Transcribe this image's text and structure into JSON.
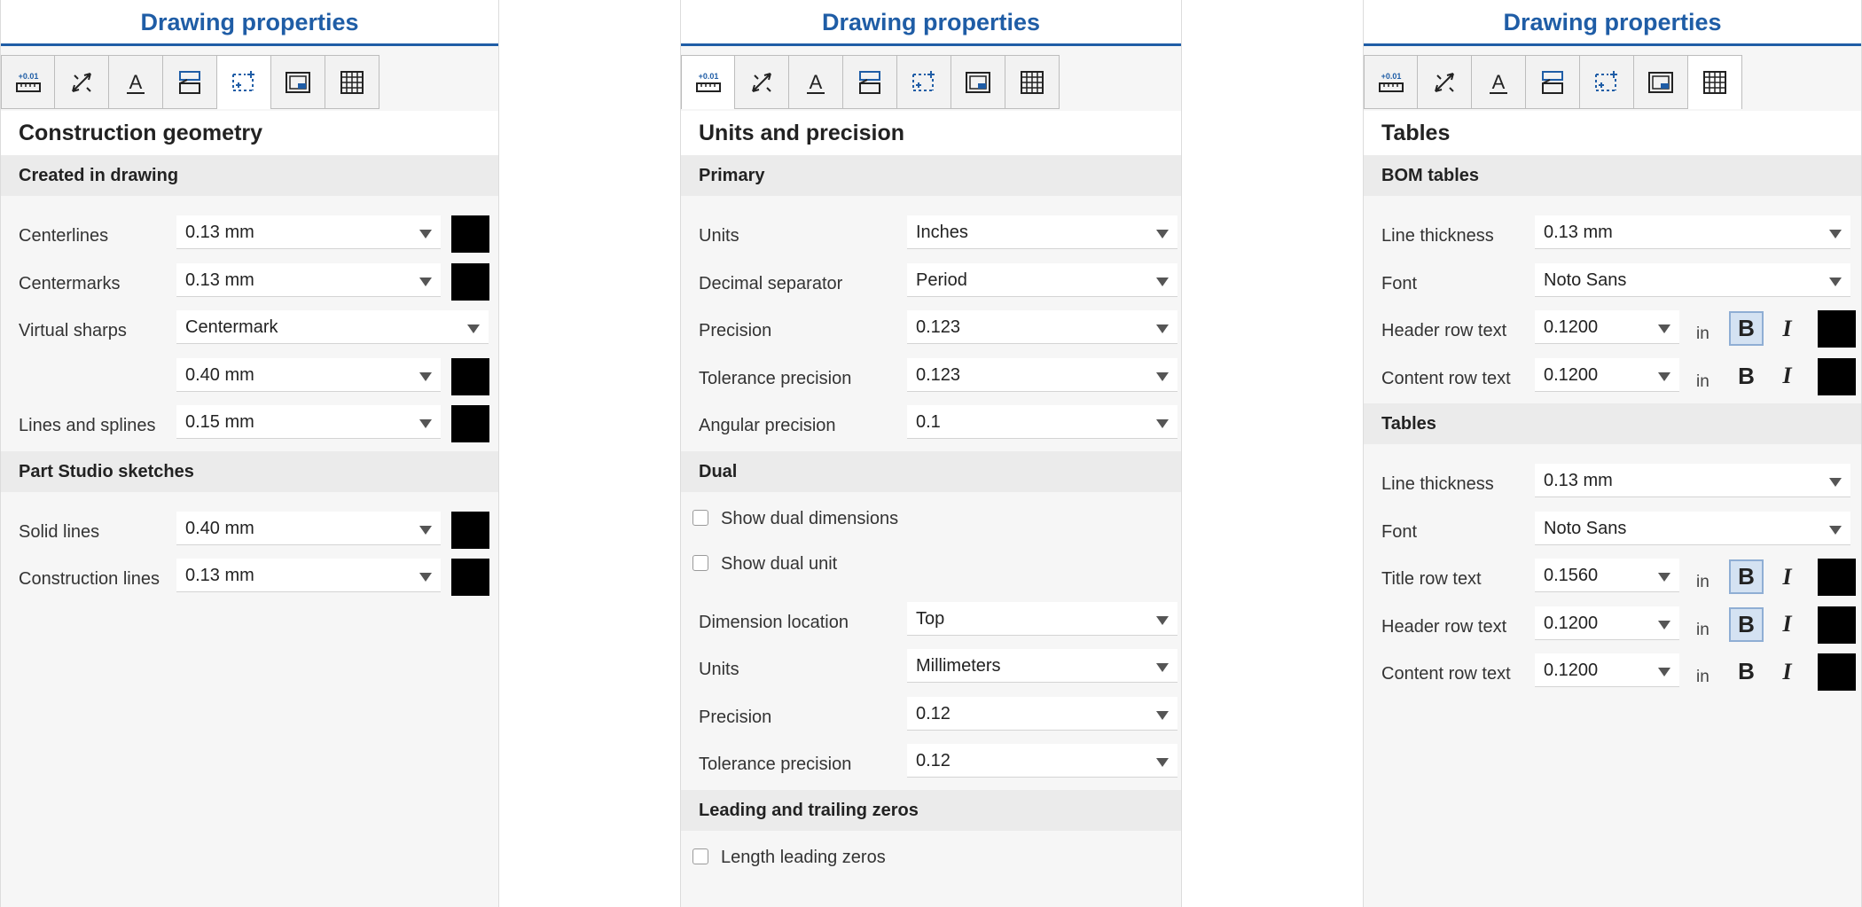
{
  "panels": [
    {
      "title": "Drawing properties",
      "section_title": "Construction geometry",
      "groups": [
        {
          "title": "Created in drawing"
        },
        {
          "title": "Part Studio sketches"
        }
      ],
      "rows": {
        "centerlines": {
          "label": "Centerlines",
          "value": "0.13 mm"
        },
        "centermarks": {
          "label": "Centermarks",
          "value": "0.13 mm"
        },
        "virtual_sharps": {
          "label": "Virtual sharps",
          "value": "Centermark"
        },
        "virtual_sharps_size": {
          "label": "",
          "value": "0.40 mm"
        },
        "lines_splines": {
          "label": "Lines and splines",
          "value": "0.15 mm"
        },
        "solid_lines": {
          "label": "Solid lines",
          "value": "0.40 mm"
        },
        "construction_lines": {
          "label": "Construction lines",
          "value": "0.13 mm"
        }
      }
    },
    {
      "title": "Drawing properties",
      "section_title": "Units and precision",
      "groups": [
        {
          "title": "Primary"
        },
        {
          "title": "Dual"
        },
        {
          "title": "Leading and trailing zeros"
        }
      ],
      "primary": [
        {
          "label": "Units",
          "value": "Inches"
        },
        {
          "label": "Decimal separator",
          "value": "Period"
        },
        {
          "label": "Precision",
          "value": "0.123"
        },
        {
          "label": "Tolerance precision",
          "value": "0.123"
        },
        {
          "label": "Angular precision",
          "value": "0.1"
        }
      ],
      "dual_checks": [
        "Show dual dimensions",
        "Show dual unit"
      ],
      "dual": [
        {
          "label": "Dimension location",
          "value": "Top"
        },
        {
          "label": "Units",
          "value": "Millimeters"
        },
        {
          "label": "Precision",
          "value": "0.12"
        },
        {
          "label": "Tolerance precision",
          "value": "0.12"
        }
      ],
      "zeros_checks": [
        "Length leading zeros"
      ]
    },
    {
      "title": "Drawing properties",
      "section_title": "Tables",
      "groups": [
        {
          "title": "BOM tables"
        },
        {
          "title": "Tables"
        }
      ],
      "unit_label": "in",
      "bold_glyph": "B",
      "italic_glyph": "I",
      "bom": {
        "line_thickness": {
          "label": "Line thickness",
          "value": "0.13 mm"
        },
        "font": {
          "label": "Font",
          "value": "Noto Sans"
        },
        "header": {
          "label": "Header row text",
          "value": "0.1200"
        },
        "content": {
          "label": "Content row text",
          "value": "0.1200"
        }
      },
      "tables": {
        "line_thickness": {
          "label": "Line thickness",
          "value": "0.13 mm"
        },
        "font": {
          "label": "Font",
          "value": "Noto Sans"
        },
        "title": {
          "label": "Title row text",
          "value": "0.1560"
        },
        "header": {
          "label": "Header row text",
          "value": "0.1200"
        },
        "content": {
          "label": "Content row text",
          "value": "0.1200"
        }
      }
    }
  ],
  "tabs": [
    {
      "icon": "units-precision-icon",
      "label": "+0.01"
    },
    {
      "icon": "dimension-arrow-icon"
    },
    {
      "icon": "text-style-icon",
      "label": "A"
    },
    {
      "icon": "annotation-icon"
    },
    {
      "icon": "construction-geometry-icon"
    },
    {
      "icon": "sheet-border-icon"
    },
    {
      "icon": "table-icon"
    }
  ],
  "colors": {
    "accent": "#1f5da6",
    "swatch": "#000000",
    "panel_bg": "#f6f6f6",
    "group_bg": "#ebebeb"
  }
}
